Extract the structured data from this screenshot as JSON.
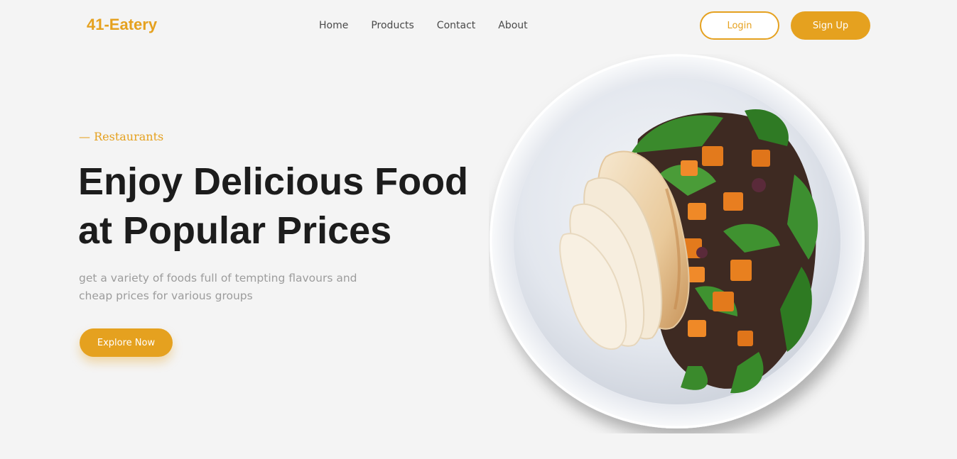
{
  "brand": {
    "name": "41-Eatery"
  },
  "nav": {
    "items": [
      {
        "label": "Home"
      },
      {
        "label": "Products"
      },
      {
        "label": "Contact"
      },
      {
        "label": "About"
      }
    ]
  },
  "auth": {
    "login_label": "Login",
    "signup_label": "Sign Up"
  },
  "hero": {
    "eyebrow": "— Restaurants",
    "headline_line1": "Enjoy Delicious Food",
    "headline_line2": "at Popular Prices",
    "subtext_line1": "get a variety of foods full of tempting flavours and",
    "subtext_line2": "cheap prices for various groups",
    "cta_label": "Explore Now",
    "image": "plate-with-sliced-chicken-and-salad"
  },
  "colors": {
    "accent": "#e5a11f",
    "background": "#f4f4f4",
    "heading": "#1c1c1c",
    "muted": "#9c9c9c"
  }
}
